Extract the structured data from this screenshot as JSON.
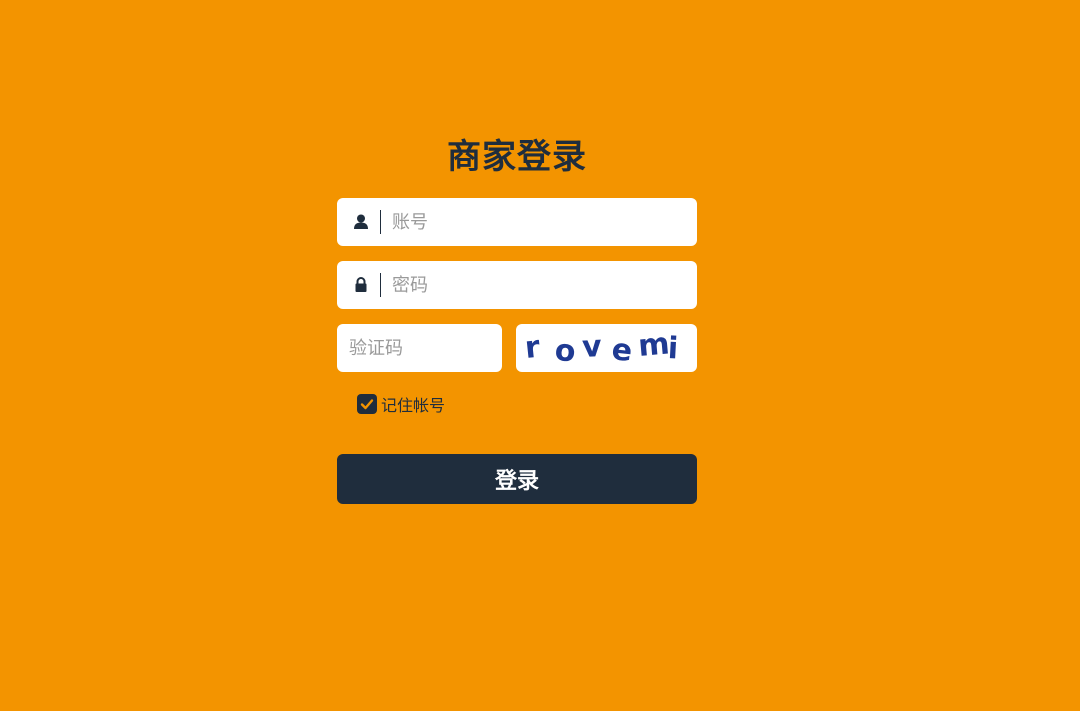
{
  "login": {
    "title": "商家登录",
    "account": {
      "placeholder": "账号",
      "value": ""
    },
    "password": {
      "placeholder": "密码",
      "value": ""
    },
    "captcha": {
      "placeholder": "验证码",
      "value": "",
      "image_text": "rovemi"
    },
    "remember": {
      "label": "记住帐号",
      "checked": true
    },
    "submit_label": "登录"
  },
  "colors": {
    "background": "#f39400",
    "primary_dark": "#1f2d3d",
    "captcha_text": "#1f3a93",
    "check_mark": "#f39400"
  },
  "icons": {
    "account": "user-icon",
    "password": "lock-icon",
    "remember": "check-icon"
  }
}
